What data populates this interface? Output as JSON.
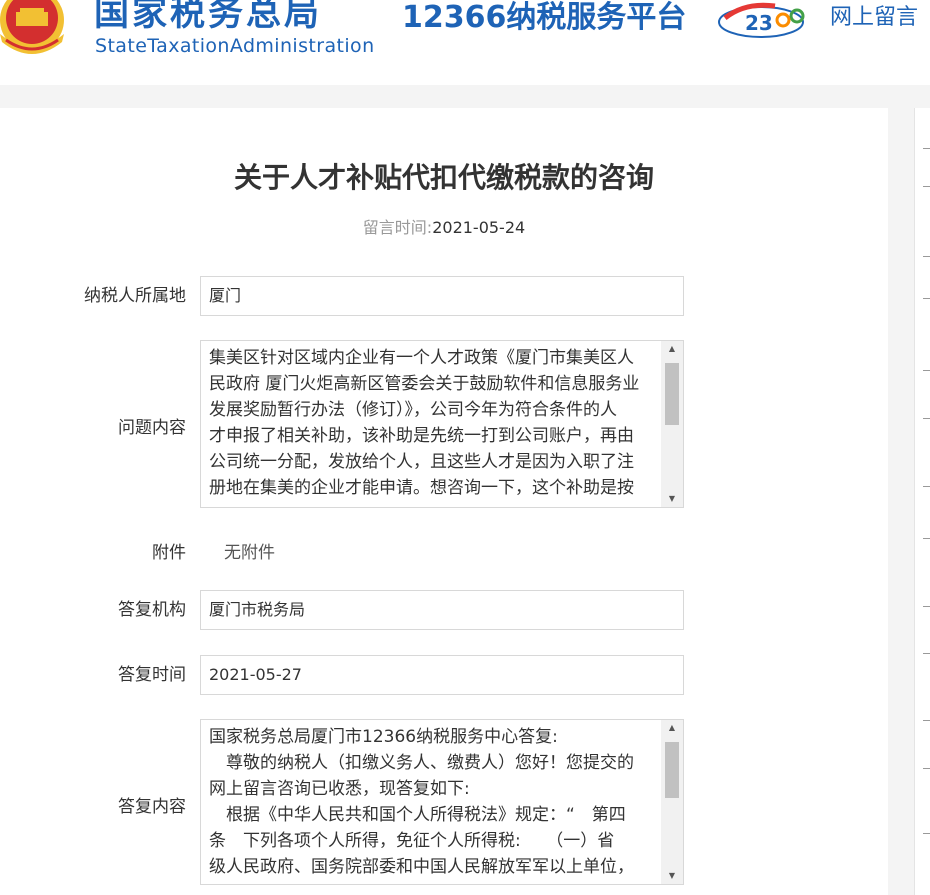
{
  "header": {
    "agency_cn": "国家税务总局",
    "agency_en": "StateTaxationAdministration",
    "platform": "12366纳税服务平台",
    "logo_text": "23",
    "message_link": "网上留言"
  },
  "consult": {
    "title": "关于人才补贴代扣代缴税款的咨询",
    "date_label": "留言时间:",
    "date_value": "2021-05-24",
    "fields": {
      "location_label": "纳税人所属地",
      "location_value": "厦门",
      "question_label": "问题内容",
      "question_lines": [
        "集美区针对区域内企业有一个人才政策《厦门市集美区人",
        "民政府 厦门火炬高新区管委会关于鼓励软件和信息服务业",
        "发展奖励暂行办法（修订）》，公司今年为符合条件的人",
        "才申报了相关补助，该补助是先统一打到公司账户，再由",
        "公司统一分配，发放给个人，且这些人才是因为入职了注",
        "册地在集美的企业才能申请。想咨询一下，这个补助是按"
      ],
      "attachment_label": "附件",
      "attachment_value": "无附件",
      "reply_org_label": "答复机构",
      "reply_org_value": "厦门市税务局",
      "reply_time_label": "答复时间",
      "reply_time_value": "2021-05-27",
      "reply_content_label": "答复内容",
      "reply_lines": [
        "国家税务总局厦门市12366纳税服务中心答复:",
        "　尊敬的纳税人（扣缴义务人、缴费人）您好！您提交的",
        "网上留言咨询已收悉，现答复如下:",
        "　根据《中华人民共和国个人所得税法》规定：“　第四",
        "条　下列各项个人所得，免征个人所得税:　　（一）省",
        "级人民政府、国务院部委和中国人民解放军军以上单位，"
      ]
    }
  },
  "colors": {
    "brand_blue": "#1e63b6",
    "emblem_red": "#d32f2f",
    "emblem_gold": "#f2c033"
  },
  "icons": {
    "emblem": "national-emblem-icon",
    "logo": "12366-logo-icon",
    "scroll_up": "scroll-up-arrow-icon",
    "scroll_down": "scroll-down-arrow-icon"
  }
}
